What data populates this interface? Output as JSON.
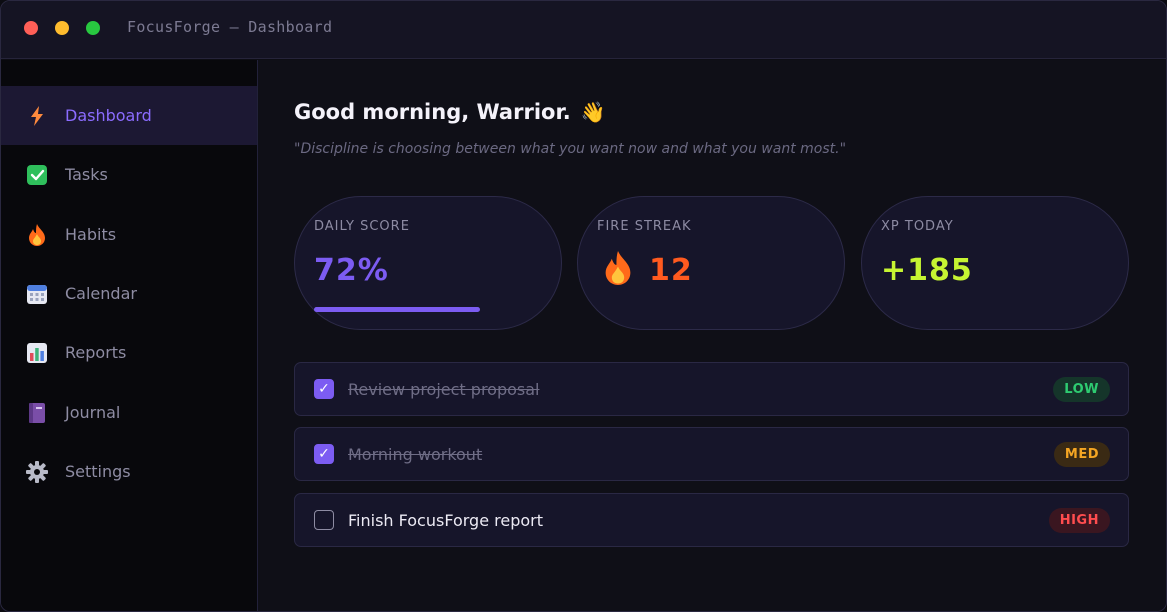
{
  "window": {
    "title": "FocusForge — Dashboard"
  },
  "sidebar": {
    "items": [
      {
        "label": "Dashboard",
        "icon": "bolt-icon",
        "active": true
      },
      {
        "label": "Tasks",
        "icon": "check-box-icon"
      },
      {
        "label": "Habits",
        "icon": "fire-icon"
      },
      {
        "label": "Calendar",
        "icon": "calendar-icon"
      },
      {
        "label": "Reports",
        "icon": "bar-chart-icon"
      },
      {
        "label": "Journal",
        "icon": "notebook-icon"
      },
      {
        "label": "Settings",
        "icon": "gear-icon"
      }
    ]
  },
  "main": {
    "greeting": "Good morning, Warrior.",
    "greeting_emoji": "👋",
    "quote": "\"Discipline is choosing between what you want now and what you want most.\"",
    "stats": {
      "daily_score": {
        "label": "DAILY SCORE",
        "value": "72%",
        "progress": 0.72,
        "color": "#7c5cf2"
      },
      "fire_streak": {
        "label": "FIRE STREAK",
        "value": "12",
        "color": "#ff5a1f"
      },
      "xp_today": {
        "label": "XP TODAY",
        "value": "+185",
        "color": "#c6f432"
      }
    },
    "tasks": [
      {
        "text": "Review project proposal",
        "done": true,
        "priority": "LOW",
        "badge_color": "#2ecc71",
        "badge_bg": "#15352a"
      },
      {
        "text": "Morning workout",
        "done": true,
        "priority": "MED",
        "badge_color": "#f5a623",
        "badge_bg": "#3a2a14"
      },
      {
        "text": "Finish FocusForge report",
        "done": false,
        "priority": "HIGH",
        "badge_color": "#ff4d4f",
        "badge_bg": "#3a1620"
      }
    ]
  },
  "colors": {
    "accent": "#7c5cf2",
    "background": "#0f0f17",
    "card": "#16152a"
  }
}
